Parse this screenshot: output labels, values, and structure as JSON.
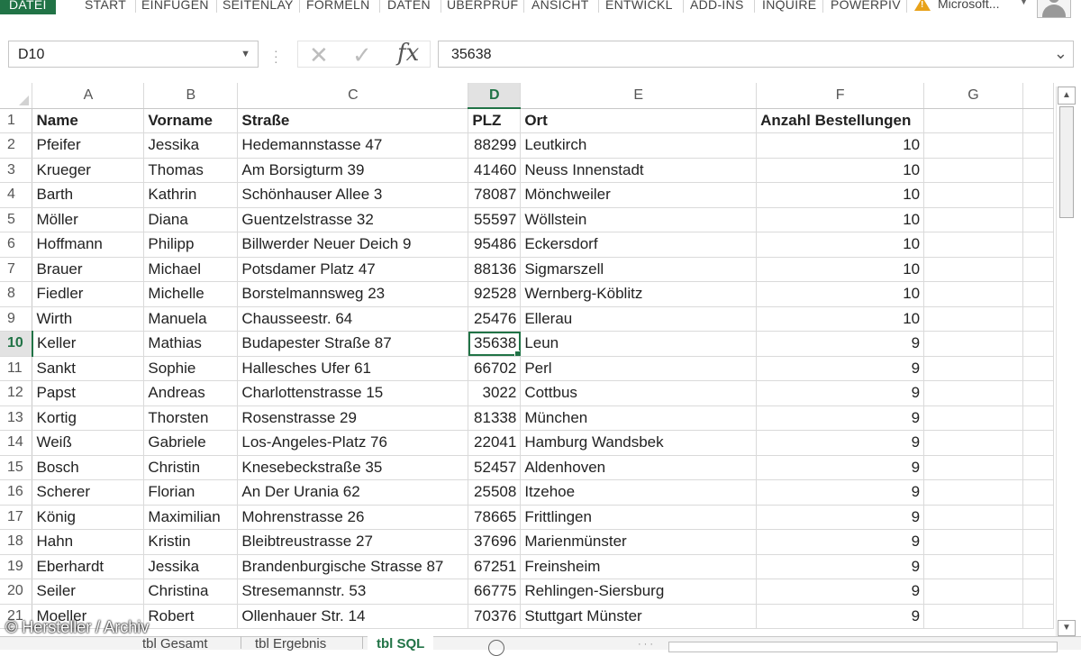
{
  "ribbon": {
    "tabs": [
      "DATEI",
      "START",
      "EINFÜGEN",
      "SEITENLAY",
      "FORMELN",
      "DATEN",
      "ÜBERPRÜF",
      "ANSICHT",
      "ENTWICKL",
      "ADD-INS",
      "INQUIRE",
      "POWERPIV"
    ],
    "account": "Microsoft..."
  },
  "formula_bar": {
    "name_box": "D10",
    "fx": "fx",
    "value": "35638"
  },
  "columns": [
    "A",
    "B",
    "C",
    "D",
    "E",
    "F",
    "G"
  ],
  "rows": [
    {
      "n": "1",
      "a": "Name",
      "b": "Vorname",
      "c": "Straße",
      "d": "PLZ",
      "e": "Ort",
      "f": "Anzahl Bestellungen"
    },
    {
      "n": "2",
      "a": "Pfeifer",
      "b": "Jessika",
      "c": "Hedemannstasse 47",
      "d": "88299",
      "e": "Leutkirch",
      "f": "10"
    },
    {
      "n": "3",
      "a": "Krueger",
      "b": "Thomas",
      "c": "Am Borsigturm 39",
      "d": "41460",
      "e": "Neuss Innenstadt",
      "f": "10"
    },
    {
      "n": "4",
      "a": "Barth",
      "b": "Kathrin",
      "c": "Schönhauser Allee 3",
      "d": "78087",
      "e": "Mönchweiler",
      "f": "10"
    },
    {
      "n": "5",
      "a": "Möller",
      "b": "Diana",
      "c": "Guentzelstrasse 32",
      "d": "55597",
      "e": "Wöllstein",
      "f": "10"
    },
    {
      "n": "6",
      "a": "Hoffmann",
      "b": "Philipp",
      "c": "Billwerder Neuer Deich 9",
      "d": "95486",
      "e": "Eckersdorf",
      "f": "10"
    },
    {
      "n": "7",
      "a": "Brauer",
      "b": "Michael",
      "c": "Potsdamer Platz 47",
      "d": "88136",
      "e": "Sigmarszell",
      "f": "10"
    },
    {
      "n": "8",
      "a": "Fiedler",
      "b": "Michelle",
      "c": "Borstelmannsweg 23",
      "d": "92528",
      "e": "Wernberg-Köblitz",
      "f": "10"
    },
    {
      "n": "9",
      "a": "Wirth",
      "b": "Manuela",
      "c": "Chausseestr. 64",
      "d": "25476",
      "e": "Ellerau",
      "f": "10"
    },
    {
      "n": "10",
      "a": "Keller",
      "b": "Mathias",
      "c": "Budapester Straße 87",
      "d": "35638",
      "e": "Leun",
      "f": "9"
    },
    {
      "n": "11",
      "a": "Sankt",
      "b": "Sophie",
      "c": "Hallesches Ufer 61",
      "d": "66702",
      "e": "Perl",
      "f": "9"
    },
    {
      "n": "12",
      "a": "Papst",
      "b": "Andreas",
      "c": "Charlottenstrasse 15",
      "d": "3022",
      "e": "Cottbus",
      "f": "9"
    },
    {
      "n": "13",
      "a": "Kortig",
      "b": "Thorsten",
      "c": "Rosenstrasse 29",
      "d": "81338",
      "e": "München",
      "f": "9"
    },
    {
      "n": "14",
      "a": "Weiß",
      "b": "Gabriele",
      "c": "Los-Angeles-Platz 76",
      "d": "22041",
      "e": "Hamburg Wandsbek",
      "f": "9"
    },
    {
      "n": "15",
      "a": "Bosch",
      "b": "Christin",
      "c": "Knesebeckstraße 35",
      "d": "52457",
      "e": "Aldenhoven",
      "f": "9"
    },
    {
      "n": "16",
      "a": "Scherer",
      "b": "Florian",
      "c": "An Der Urania 62",
      "d": "25508",
      "e": "Itzehoe",
      "f": "9"
    },
    {
      "n": "17",
      "a": "König",
      "b": "Maximilian",
      "c": "Mohrenstrasse 26",
      "d": "78665",
      "e": "Frittlingen",
      "f": "9"
    },
    {
      "n": "18",
      "a": "Hahn",
      "b": "Kristin",
      "c": "Bleibtreustrasse 27",
      "d": "37696",
      "e": "Marienmünster",
      "f": "9"
    },
    {
      "n": "19",
      "a": "Eberhardt",
      "b": "Jessika",
      "c": "Brandenburgische Strasse 87",
      "d": "67251",
      "e": "Freinsheim",
      "f": "9"
    },
    {
      "n": "20",
      "a": "Seiler",
      "b": "Christina",
      "c": "Stresemannstr. 53",
      "d": "66775",
      "e": "Rehlingen-Siersburg",
      "f": "9"
    },
    {
      "n": "21",
      "a": "Moeller",
      "b": "Robert",
      "c": "Ollenhauer Str. 14",
      "d": "70376",
      "e": "Stuttgart Münster",
      "f": "9"
    }
  ],
  "sheet_tabs": [
    "tbl Gesamt",
    "tbl Ergebnis",
    "tbl SQL"
  ],
  "watermark": "© Hersteller / Archiv",
  "colors": {
    "accent": "#217346",
    "grid": "#dadada"
  }
}
